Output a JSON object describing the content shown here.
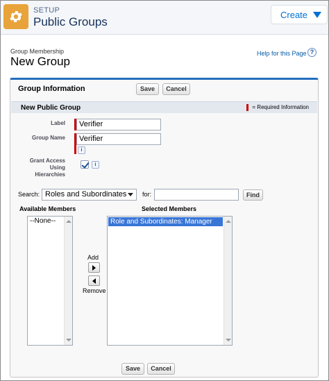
{
  "header": {
    "section_label": "SETUP",
    "title": "Public Groups",
    "create_label": "Create",
    "setup_icon": "gear-icon"
  },
  "page": {
    "subtitle": "Group Membership",
    "title": "New Group",
    "help_link": "Help for this Page",
    "help_icon": "help-icon"
  },
  "panel": {
    "title": "Group Information",
    "save_label": "Save",
    "cancel_label": "Cancel",
    "section_title": "New Public Group",
    "required_legend": "= Required Information"
  },
  "form": {
    "label_label": "Label",
    "label_value": "Verifier",
    "group_name_label": "Group Name",
    "group_name_value": "Verifier",
    "info_glyph": "i",
    "grant_access_label_1": "Grant Access",
    "grant_access_label_2": "Using",
    "grant_access_label_3": "Hierarchies",
    "grant_access_checked": true
  },
  "search": {
    "search_label": "Search:",
    "search_selected": "Roles and Subordinates",
    "for_label": "for:",
    "for_value": "",
    "find_label": "Find"
  },
  "members": {
    "available_header": "Available Members",
    "available_items": [
      "--None--"
    ],
    "selected_header": "Selected Members",
    "selected_items": [
      "Role and Subordinates: Manager"
    ],
    "add_label": "Add",
    "remove_label": "Remove"
  },
  "colors": {
    "accent": "#236fbd",
    "setup_icon_bg": "#e8a33a",
    "required": "#cc0000",
    "selection": "#3875d7"
  }
}
